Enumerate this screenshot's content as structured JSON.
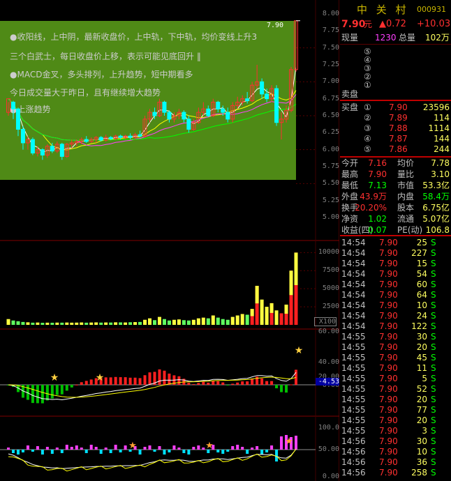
{
  "header": {
    "name": "中 关 村",
    "code": "000931",
    "price": "7.90",
    "price_unit": "元",
    "change": "▲0.72",
    "change_pct": "+10.03"
  },
  "volume_row": {
    "now_label": "现量",
    "now_value": "1230",
    "total_label": "总量",
    "total_value": "102万"
  },
  "sell_side": {
    "label": "卖盘",
    "levels": [
      "⑤",
      "④",
      "③",
      "②",
      "①"
    ]
  },
  "buy_side": {
    "label": "买盘",
    "levels": [
      {
        "idx": "①",
        "price": "7.90",
        "vol": "23596"
      },
      {
        "idx": "②",
        "price": "7.89",
        "vol": "114"
      },
      {
        "idx": "③",
        "price": "7.88",
        "vol": "1114"
      },
      {
        "idx": "④",
        "price": "7.87",
        "vol": "144"
      },
      {
        "idx": "⑤",
        "price": "7.86",
        "vol": "244"
      }
    ]
  },
  "stats": [
    {
      "l1": "今开",
      "v1": "7.16",
      "l2": "均价",
      "v2": "7.78"
    },
    {
      "l1": "最高",
      "v1": "7.90",
      "l2": "量比",
      "v2": "3.10"
    },
    {
      "l1": "最低",
      "v1": "7.13",
      "l2": "市值",
      "v2": "53.3亿"
    },
    {
      "l1": "外盘",
      "v1": "43.9万",
      "l2": "内盘",
      "v2": "58.4万"
    },
    {
      "l1": "换手",
      "v1": "20.20%",
      "l2": "股本",
      "v2": "6.75亿"
    },
    {
      "l1": "净资",
      "v1": "1.02",
      "l2": "流通",
      "v2": "5.07亿"
    },
    {
      "l1": "收益(四)",
      "v1": "0.07",
      "l2": "PE(动)",
      "v2": "106.8"
    }
  ],
  "trades": [
    {
      "t": "14:54",
      "p": "7.90",
      "v": "25",
      "s": "S"
    },
    {
      "t": "14:54",
      "p": "7.90",
      "v": "227",
      "s": "S"
    },
    {
      "t": "14:54",
      "p": "7.90",
      "v": "15",
      "s": "S"
    },
    {
      "t": "14:54",
      "p": "7.90",
      "v": "54",
      "s": "S"
    },
    {
      "t": "14:54",
      "p": "7.90",
      "v": "60",
      "s": "S"
    },
    {
      "t": "14:54",
      "p": "7.90",
      "v": "64",
      "s": "S"
    },
    {
      "t": "14:54",
      "p": "7.90",
      "v": "10",
      "s": "S"
    },
    {
      "t": "14:54",
      "p": "7.90",
      "v": "24",
      "s": "S"
    },
    {
      "t": "14:54",
      "p": "7.90",
      "v": "122",
      "s": "S"
    },
    {
      "t": "14:55",
      "p": "7.90",
      "v": "30",
      "s": "S"
    },
    {
      "t": "14:55",
      "p": "7.90",
      "v": "20",
      "s": "S"
    },
    {
      "t": "14:55",
      "p": "7.90",
      "v": "45",
      "s": "S"
    },
    {
      "t": "14:55",
      "p": "7.90",
      "v": "11",
      "s": "S"
    },
    {
      "t": "14:55",
      "p": "7.90",
      "v": "5",
      "s": "S"
    },
    {
      "t": "14:55",
      "p": "7.90",
      "v": "52",
      "s": "S"
    },
    {
      "t": "14:55",
      "p": "7.90",
      "v": "20",
      "s": "S"
    },
    {
      "t": "14:55",
      "p": "7.90",
      "v": "77",
      "s": "S"
    },
    {
      "t": "14:55",
      "p": "7.90",
      "v": "20",
      "s": "S"
    },
    {
      "t": "14:55",
      "p": "7.90",
      "v": "3",
      "s": "S"
    },
    {
      "t": "14:56",
      "p": "7.90",
      "v": "30",
      "s": "S"
    },
    {
      "t": "14:56",
      "p": "7.90",
      "v": "10",
      "s": "S"
    },
    {
      "t": "14:56",
      "p": "7.90",
      "v": "36",
      "s": "S"
    },
    {
      "t": "14:56",
      "p": "7.90",
      "v": "258",
      "s": "S"
    }
  ],
  "info_lines": [
    {
      "text": "●收阳线，上中阴，最新收盘价，上中轨，下中轨，均价变线上升3",
      "color": "#e02020"
    },
    {
      "text": "三个白武士，每日收盘价上移，表示可能见底回升 ‖",
      "color": "#ffffff"
    },
    {
      "text": "●MACD金叉，多头排列，上升趋势，短中期看多",
      "color": "#e02020"
    },
    {
      "text": "今日成交量大于昨日，且有继续增大趋势",
      "color": "#ffff60"
    },
    {
      "text": "●上涨趋势",
      "color": "#e02020"
    }
  ],
  "axes": {
    "price_ticks": [
      "8.00",
      "7.75",
      "7.50",
      "7.25",
      "7.00",
      "6.75",
      "6.50",
      "6.25",
      "6.00",
      "5.75",
      "5.50",
      "5.25",
      "5.00"
    ],
    "vol_ticks": [
      "10000",
      "7500",
      "5000",
      "2500"
    ],
    "vol_unit": "X100",
    "macd_ticks": [
      "60.00",
      "40.00",
      "20.00",
      "0.00"
    ],
    "macd_value": "-4.53",
    "kdj_ticks": [
      "100.0",
      "50.00",
      "0.00"
    ],
    "last_price_tag": "7.90"
  },
  "colors": {
    "up": "#ff3030",
    "down": "#00ffff",
    "green_bg": "#4f8a16",
    "yellow": "#ffff00",
    "header_yellow": "#c8b400"
  },
  "chart_data": {
    "type": "candlestick",
    "ylim": [
      5.0,
      8.0
    ],
    "candles": [
      [
        6.55,
        6.75,
        6.5,
        6.7
      ],
      [
        6.7,
        6.6,
        6.45,
        6.72
      ],
      [
        6.6,
        6.3,
        6.2,
        6.62
      ],
      [
        6.3,
        6.1,
        6.0,
        6.35
      ],
      [
        6.1,
        6.15,
        6.0,
        6.2
      ],
      [
        6.15,
        5.95,
        5.92,
        6.18
      ],
      [
        5.95,
        6.0,
        5.9,
        6.05
      ],
      [
        6.0,
        5.92,
        5.85,
        6.02
      ],
      [
        5.92,
        6.05,
        5.88,
        6.08
      ],
      [
        6.05,
        5.98,
        5.95,
        6.1
      ],
      [
        5.98,
        6.08,
        5.95,
        6.12
      ],
      [
        6.08,
        5.9,
        5.85,
        6.1
      ],
      [
        5.9,
        6.08,
        5.88,
        6.1
      ],
      [
        6.08,
        6.1,
        6.02,
        6.15
      ],
      [
        6.1,
        6.12,
        6.05,
        6.15
      ],
      [
        6.12,
        6.15,
        6.08,
        6.18
      ],
      [
        6.15,
        6.12,
        6.1,
        6.2
      ],
      [
        6.12,
        6.15,
        6.1,
        6.18
      ],
      [
        6.15,
        6.18,
        6.1,
        6.2
      ],
      [
        6.18,
        6.14,
        6.12,
        6.2
      ],
      [
        6.14,
        6.18,
        6.12,
        6.22
      ],
      [
        6.18,
        6.16,
        6.14,
        6.2
      ],
      [
        6.16,
        6.2,
        6.14,
        6.22
      ],
      [
        6.2,
        6.18,
        6.15,
        6.22
      ],
      [
        6.18,
        6.2,
        6.15,
        6.22
      ],
      [
        6.2,
        6.18,
        6.15,
        6.24
      ],
      [
        6.18,
        6.22,
        6.15,
        6.25
      ],
      [
        6.22,
        6.2,
        6.18,
        6.28
      ],
      [
        6.2,
        6.45,
        6.18,
        6.5
      ],
      [
        6.45,
        6.55,
        6.4,
        6.6
      ],
      [
        6.55,
        6.5,
        6.45,
        6.62
      ],
      [
        6.5,
        6.7,
        6.48,
        6.75
      ],
      [
        6.7,
        6.55,
        6.5,
        6.72
      ],
      [
        6.55,
        6.45,
        6.4,
        6.58
      ],
      [
        6.45,
        6.5,
        6.4,
        6.55
      ],
      [
        6.5,
        6.55,
        6.45,
        6.6
      ],
      [
        6.55,
        6.45,
        6.4,
        6.58
      ],
      [
        6.45,
        6.3,
        6.25,
        6.5
      ],
      [
        6.3,
        6.4,
        6.28,
        6.45
      ],
      [
        6.4,
        6.55,
        6.38,
        6.62
      ],
      [
        6.55,
        6.6,
        6.5,
        6.7
      ],
      [
        6.6,
        6.5,
        6.48,
        6.65
      ],
      [
        6.5,
        6.7,
        6.48,
        6.75
      ],
      [
        6.7,
        6.6,
        6.55,
        6.72
      ],
      [
        6.6,
        6.55,
        6.5,
        6.65
      ],
      [
        6.55,
        6.45,
        6.4,
        6.62
      ],
      [
        6.45,
        6.65,
        6.4,
        6.7
      ],
      [
        6.65,
        6.7,
        6.6,
        6.78
      ],
      [
        6.7,
        6.75,
        6.65,
        6.8
      ],
      [
        6.75,
        6.72,
        6.68,
        6.85
      ],
      [
        6.72,
        6.95,
        6.7,
        7.0
      ],
      [
        6.95,
        7.0,
        6.9,
        7.25
      ],
      [
        7.0,
        6.82,
        6.75,
        7.05
      ],
      [
        6.82,
        6.75,
        6.7,
        6.9
      ],
      [
        6.75,
        6.9,
        6.7,
        6.95
      ],
      [
        6.9,
        6.4,
        6.35,
        6.95
      ],
      [
        6.4,
        6.45,
        6.15,
        6.55
      ],
      [
        6.45,
        6.58,
        6.4,
        6.65
      ],
      [
        6.58,
        7.18,
        6.55,
        7.22
      ],
      [
        7.18,
        7.9,
        7.15,
        7.9
      ]
    ],
    "volumes": [
      800,
      600,
      500,
      400,
      350,
      300,
      320,
      280,
      300,
      290,
      310,
      300,
      320,
      300,
      310,
      330,
      300,
      320,
      340,
      310,
      330,
      320,
      350,
      340,
      330,
      360,
      380,
      400,
      700,
      900,
      650,
      1100,
      800,
      600,
      700,
      750,
      650,
      600,
      700,
      900,
      1000,
      900,
      1300,
      1000,
      800,
      700,
      1100,
      1300,
      1500,
      1400,
      2200,
      5400,
      3500,
      2500,
      3000,
      2000,
      1600,
      2800,
      7500,
      10000
    ]
  }
}
